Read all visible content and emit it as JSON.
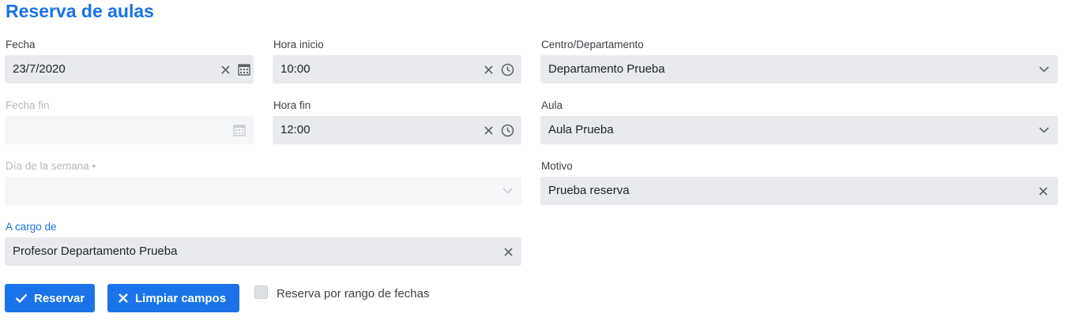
{
  "title": "Reserva de aulas",
  "fields": {
    "fecha": {
      "label": "Fecha",
      "value": "23/7/2020"
    },
    "hora_inicio": {
      "label": "Hora inicio",
      "value": "10:00"
    },
    "centro": {
      "label": "Centro/Departamento",
      "value": "Departamento Prueba"
    },
    "fecha_fin": {
      "label": "Fecha fin",
      "value": ""
    },
    "hora_fin": {
      "label": "Hora fin",
      "value": "12:00"
    },
    "aula": {
      "label": "Aula",
      "value": "Aula Prueba"
    },
    "dia_semana": {
      "label": "Día de la semana •",
      "value": ""
    },
    "motivo": {
      "label": "Motivo",
      "value": "Prueba reserva"
    },
    "a_cargo": {
      "label": "A cargo de",
      "value": "Profesor Departamento Prueba"
    }
  },
  "buttons": {
    "reservar": "Reservar",
    "limpiar": "Limpiar campos"
  },
  "checkbox": {
    "label": "Reserva por rango de fechas",
    "checked": false
  },
  "colors": {
    "accent": "#1a73e8",
    "field_bg": "#e8eaee",
    "field_disabled_bg": "#f5f6f8"
  },
  "icons": [
    "close-icon",
    "calendar-icon",
    "clock-icon",
    "chevron-down-icon",
    "check-icon"
  ]
}
